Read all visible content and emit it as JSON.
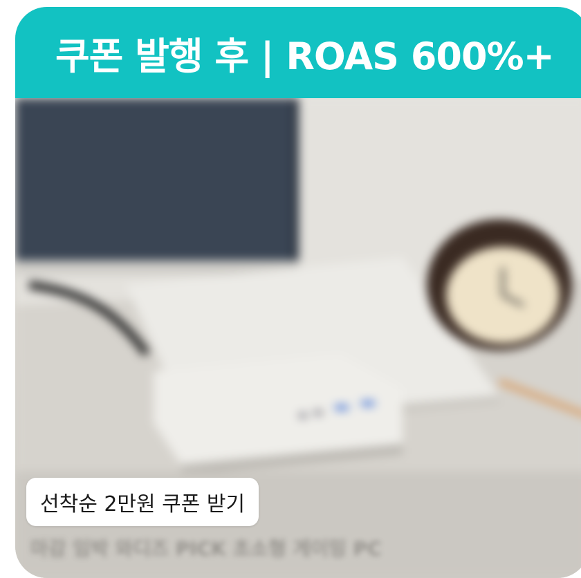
{
  "banner": {
    "title": "쿠폰 발행 후 | ROAS 600%+",
    "color": "#12c2c2"
  },
  "photo": {
    "subject": "mini-pc-desk-photo"
  },
  "coupon": {
    "label": "선착순 2만원 쿠폰 받기"
  },
  "caption": {
    "text": "마감 임박 와디즈 PICK 초소형 게이밍 PC"
  }
}
